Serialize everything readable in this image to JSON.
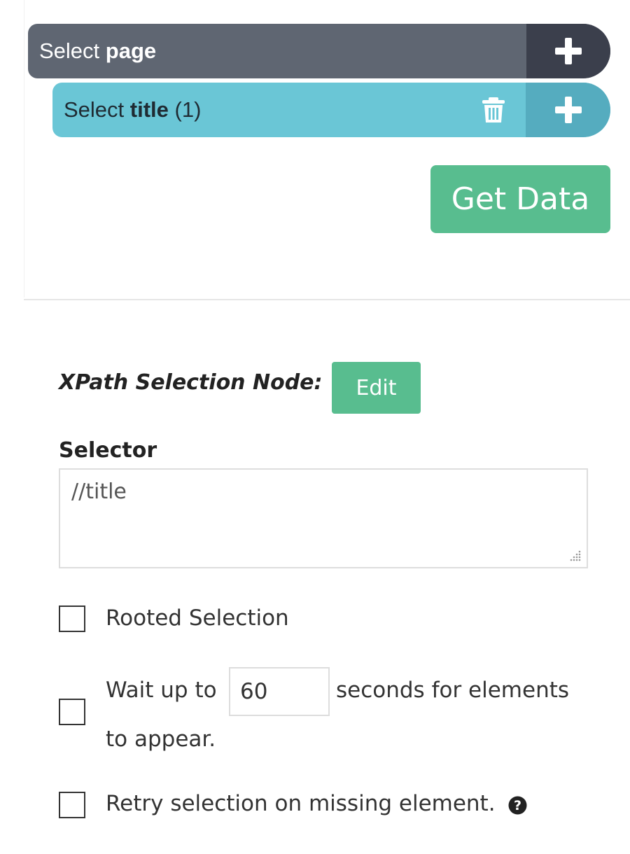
{
  "nodes": {
    "page": {
      "prefix": "Select",
      "name": "page"
    },
    "title": {
      "prefix": "Select",
      "name": "title",
      "count": "(1)"
    }
  },
  "actions": {
    "get_data_label": "Get Data"
  },
  "detail": {
    "node_type_label": "XPath Selection Node:",
    "edit_label": "Edit",
    "selector_label": "Selector",
    "selector_value": "//title",
    "rooted_label": "Rooted Selection",
    "wait_prefix": "Wait up to",
    "wait_seconds": "60",
    "wait_suffix_line1": "seconds for elements",
    "wait_suffix_line2": "to appear.",
    "retry_label": "Retry selection on missing element."
  },
  "colors": {
    "page_bar": "#5f6672",
    "page_bar_add": "#3b3f4c",
    "title_bar": "#6ac6d6",
    "title_bar_add": "#55acbf",
    "accent_green": "#58bd8f"
  },
  "icons": {
    "add": "plus-icon",
    "delete": "trash-icon",
    "help": "question-circle-icon",
    "resize": "resize-grip-icon"
  },
  "checkboxes": {
    "rooted": false,
    "wait": false,
    "retry": false
  }
}
